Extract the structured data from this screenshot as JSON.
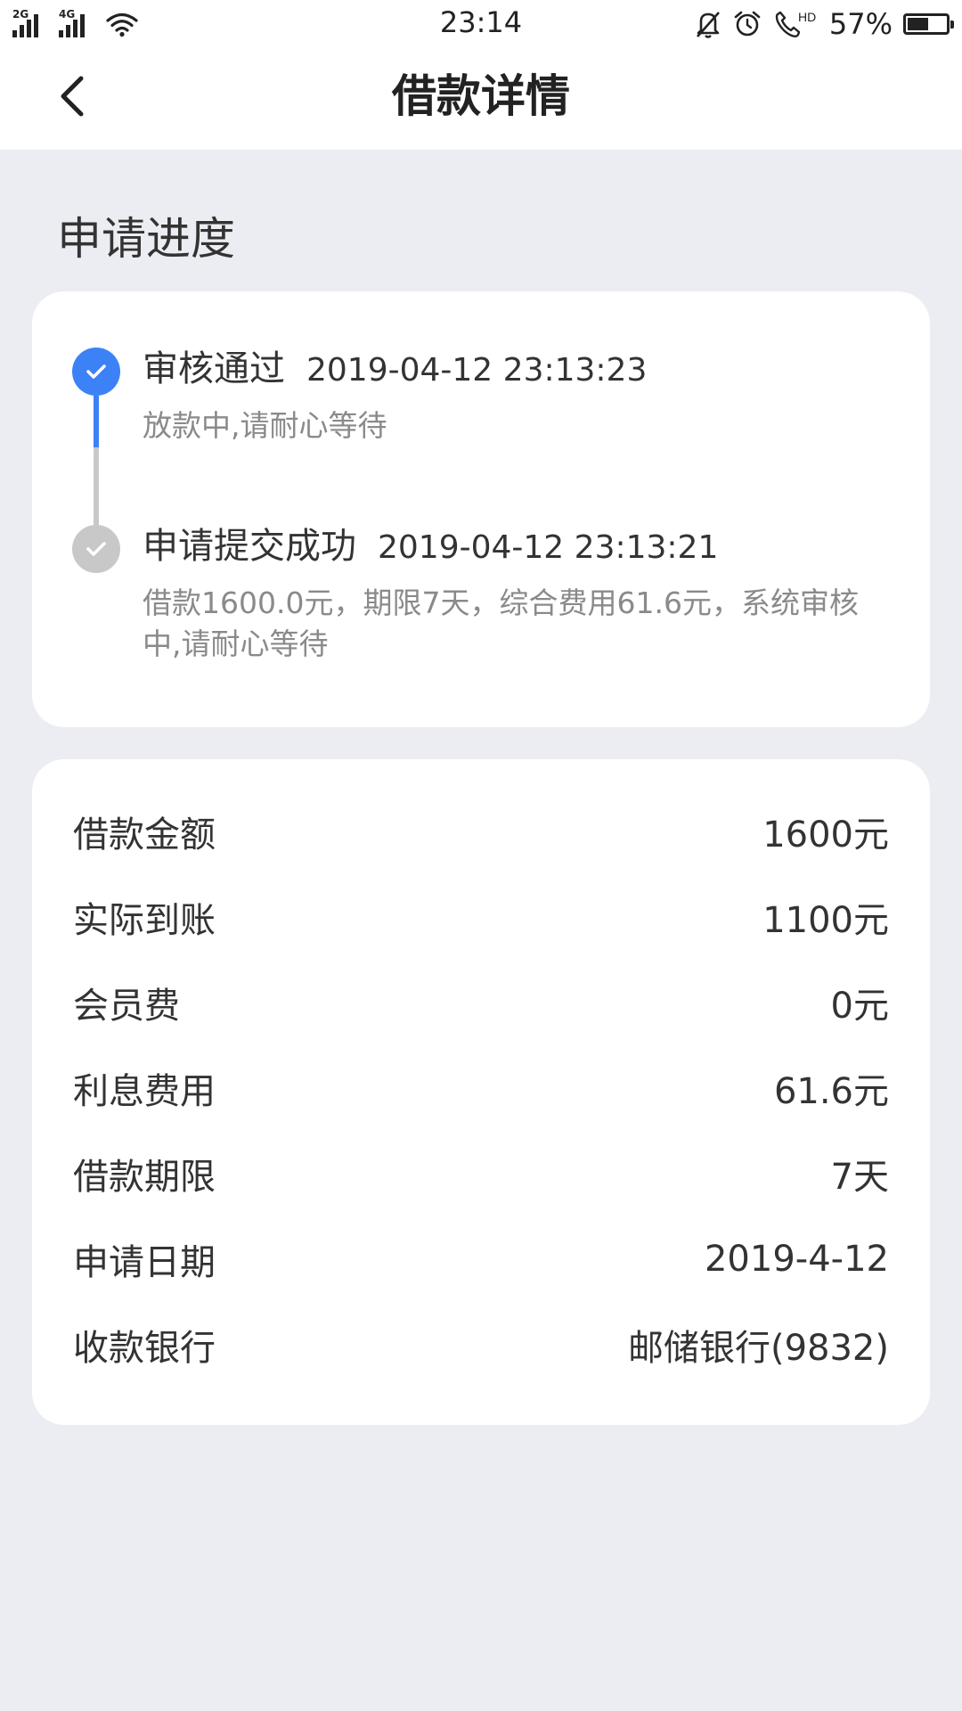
{
  "status_bar": {
    "sim1": "2G",
    "sim2": "4G",
    "time": "23:14",
    "hd": "HD",
    "battery_pct": "57%",
    "battery_level": 0.57
  },
  "header": {
    "title": "借款详情",
    "back_icon": "chevron-left-icon"
  },
  "progress": {
    "title": "申请进度",
    "steps": [
      {
        "status": "审核通过",
        "time": "2019-04-12 23:13:23",
        "desc": "放款中,请耐心等待",
        "state": "active",
        "color": "#3c82f6"
      },
      {
        "status": "申请提交成功",
        "time": "2019-04-12 23:13:21",
        "desc": "借款1600.0元，期限7天，综合费用61.6元，系统审核中,请耐心等待",
        "state": "done",
        "color": "#c8c8c8"
      }
    ]
  },
  "details": {
    "rows": [
      {
        "label": "借款金额",
        "value": "1600元"
      },
      {
        "label": "实际到账",
        "value": "1100元"
      },
      {
        "label": "会员费",
        "value": "0元"
      },
      {
        "label": "利息费用",
        "value": "61.6元"
      },
      {
        "label": "借款期限",
        "value": "7天"
      },
      {
        "label": "申请日期",
        "value": "2019-4-12"
      },
      {
        "label": "收款银行",
        "value": "邮储银行(9832)"
      }
    ]
  },
  "colors": {
    "accent": "#3c82f6",
    "inactive": "#c8c8c8",
    "background": "#ecedf2"
  }
}
